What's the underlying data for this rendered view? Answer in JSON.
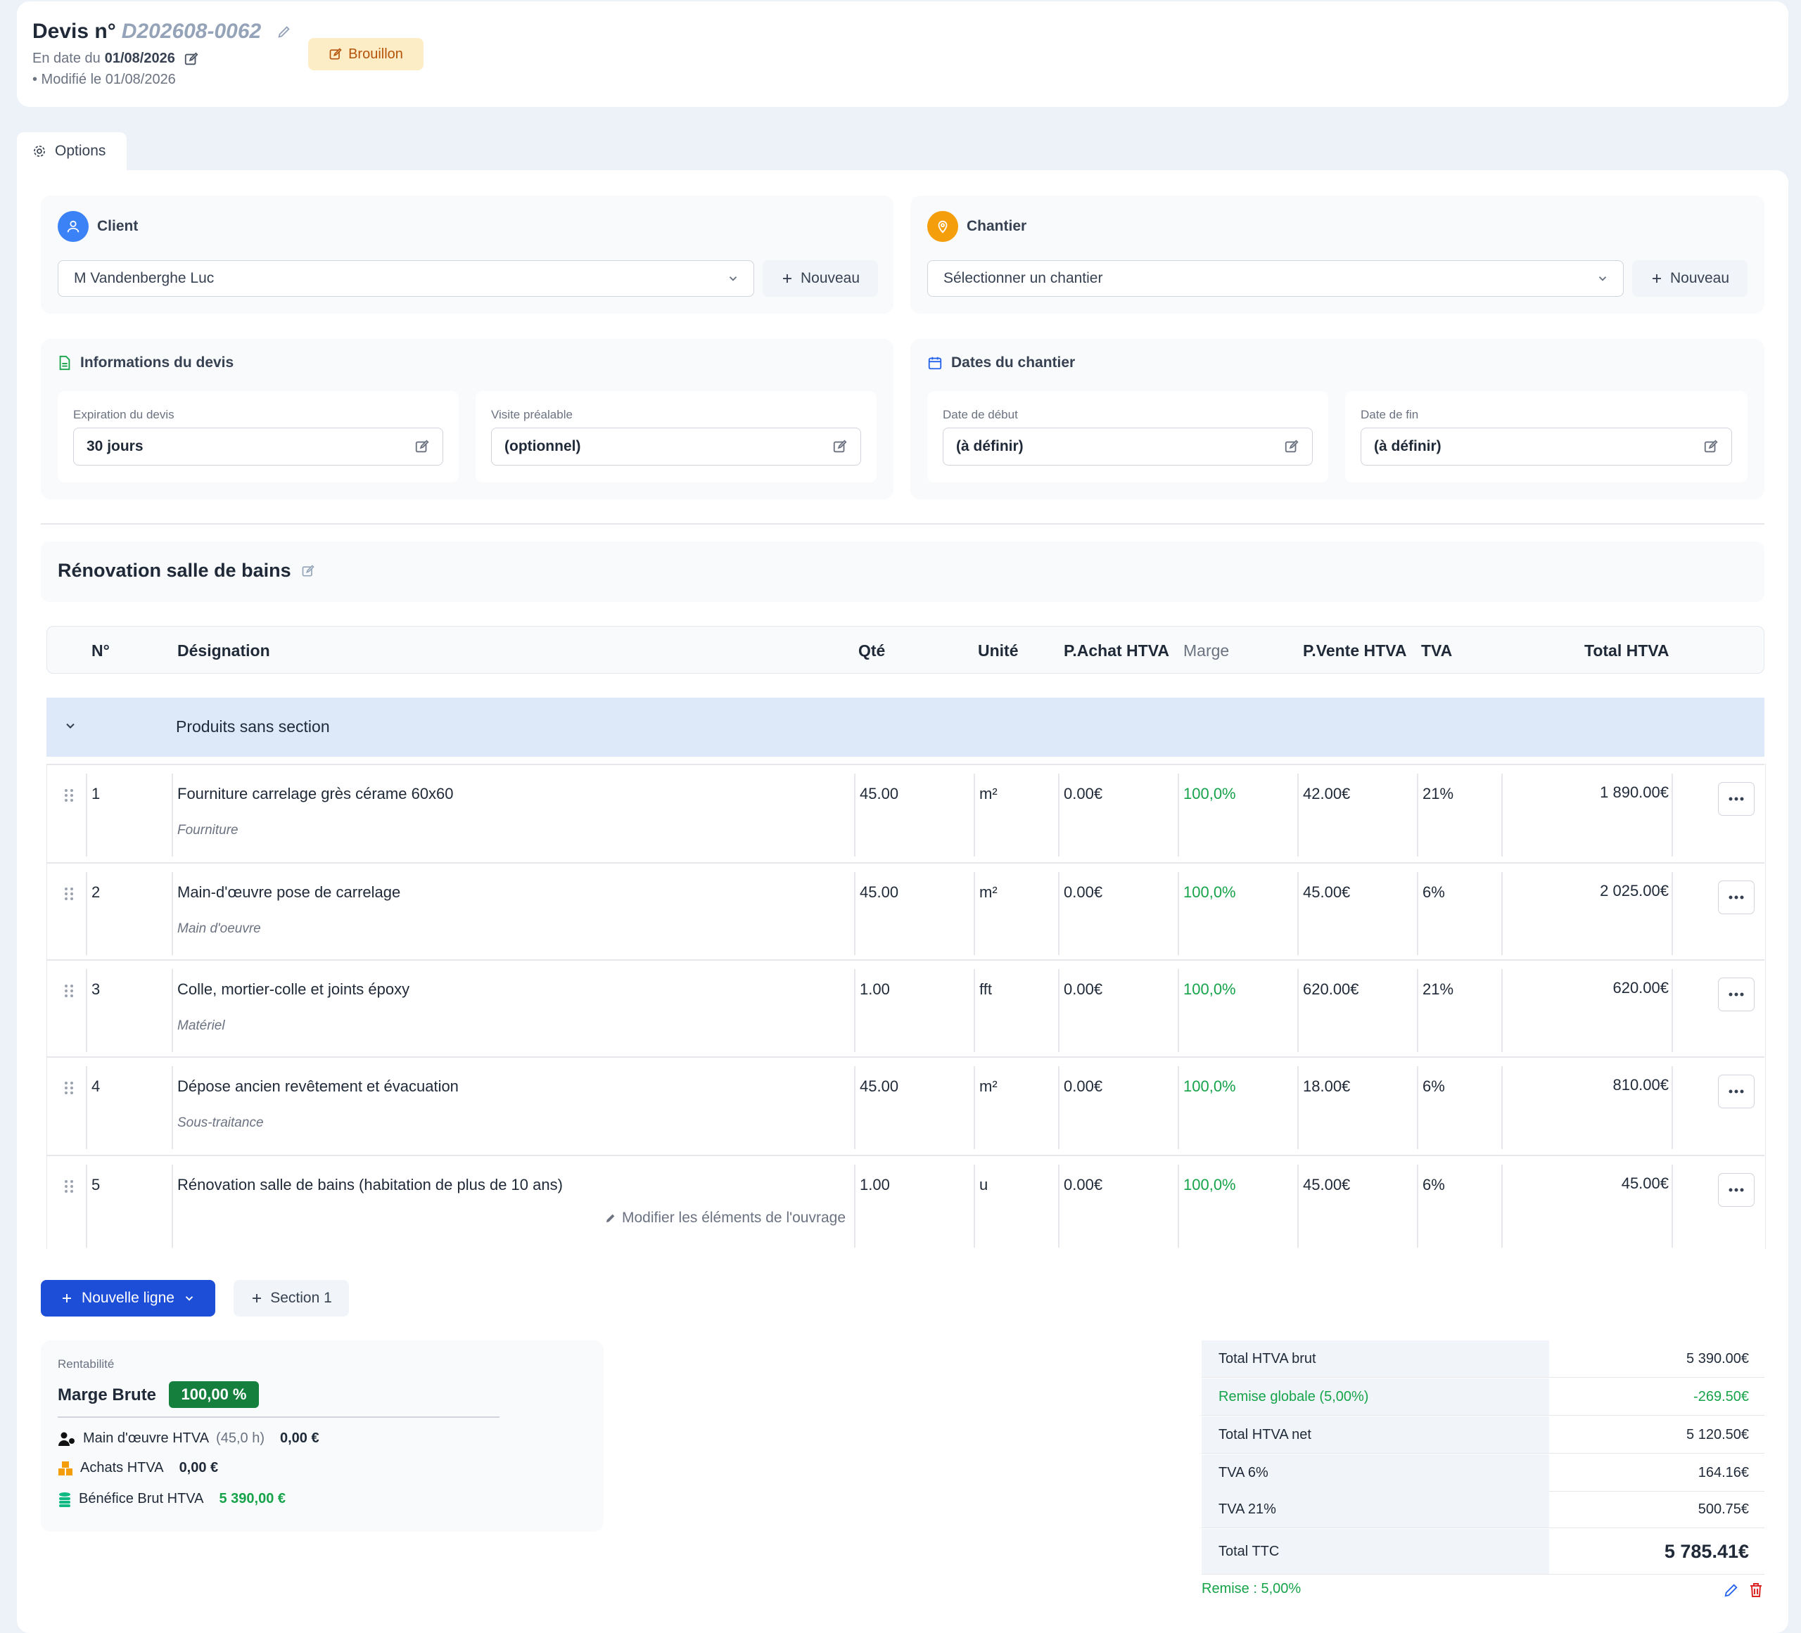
{
  "header": {
    "title_label": "Devis n°",
    "number": "D202608-0062",
    "date_prefix": "En date du",
    "date": "01/08/2026",
    "modified": "• Modifié le 01/08/2026",
    "status": "Brouillon"
  },
  "options_tab": "Options",
  "client": {
    "title": "Client",
    "selected": "M Vandenberghe Luc",
    "new_label": "Nouveau"
  },
  "chantier": {
    "title": "Chantier",
    "placeholder": "Sélectionner un chantier",
    "new_label": "Nouveau"
  },
  "info": {
    "title": "Informations du devis",
    "expiration_label": "Expiration du devis",
    "expiration_value": "30 jours",
    "visite_label": "Visite préalable",
    "visite_value": "(optionnel)"
  },
  "dates": {
    "title": "Dates du chantier",
    "start_label": "Date de début",
    "start_value": "(à définir)",
    "end_label": "Date de fin",
    "end_value": "(à définir)"
  },
  "section_title": "Rénovation salle de bains",
  "table": {
    "headers": {
      "num": "N°",
      "designation": "Désignation",
      "qty": "Qté",
      "unit": "Unité",
      "buy": "P.Achat HTVA",
      "margin": "Marge",
      "sell": "P.Vente HTVA",
      "vat": "TVA",
      "total": "Total HTVA"
    },
    "group_label": "Produits sans section",
    "rows": [
      {
        "num": "1",
        "designation": "Fourniture carrelage grès cérame 60x60",
        "category": "Fourniture",
        "qty": "45.00",
        "unit": "m²",
        "buy": "0.00€",
        "margin": "100,0%",
        "sell": "42.00€",
        "vat": "21%",
        "total": "1 890.00€"
      },
      {
        "num": "2",
        "designation": "Main-d'œuvre pose de carrelage",
        "category": "Main d'oeuvre",
        "qty": "45.00",
        "unit": "m²",
        "buy": "0.00€",
        "margin": "100,0%",
        "sell": "45.00€",
        "vat": "6%",
        "total": "2 025.00€"
      },
      {
        "num": "3",
        "designation": "Colle, mortier-colle et joints époxy",
        "category": "Matériel",
        "qty": "1.00",
        "unit": "fft",
        "buy": "0.00€",
        "margin": "100,0%",
        "sell": "620.00€",
        "vat": "21%",
        "total": "620.00€"
      },
      {
        "num": "4",
        "designation": "Dépose ancien revêtement et évacuation",
        "category": "Sous-traitance",
        "qty": "45.00",
        "unit": "m²",
        "buy": "0.00€",
        "margin": "100,0%",
        "sell": "18.00€",
        "vat": "6%",
        "total": "810.00€"
      },
      {
        "num": "5",
        "designation": "Rénovation salle de bains (habitation de plus de 10 ans)",
        "category": "",
        "qty": "1.00",
        "unit": "u",
        "buy": "0.00€",
        "margin": "100,0%",
        "sell": "45.00€",
        "vat": "6%",
        "total": "45.00€"
      }
    ],
    "edit_ouvrage": "Modifier les éléments de l'ouvrage"
  },
  "actions": {
    "new_line": "Nouvelle ligne",
    "section": "Section 1"
  },
  "profitability": {
    "label": "Rentabilité",
    "marge_title": "Marge Brute",
    "marge_value": "100,00 %",
    "labor_label": "Main d'œuvre HTVA",
    "labor_hours": "(45,0 h)",
    "labor_value": "0,00 €",
    "purchases_label": "Achats HTVA",
    "purchases_value": "0,00 €",
    "profit_label": "Bénéfice Brut HTVA",
    "profit_value": "5 390,00 €"
  },
  "totals": [
    {
      "label": "Total HTVA brut",
      "value": "5 390.00€"
    },
    {
      "label": "Remise globale (5,00%)",
      "value": "-269.50€"
    },
    {
      "label": "Total HTVA net",
      "value": "5 120.50€"
    },
    {
      "label": "TVA 6%",
      "value": "164.16€"
    },
    {
      "label": "TVA 21%",
      "value": "500.75€"
    },
    {
      "label": "Total TTC",
      "value": "5 785.41€"
    }
  ],
  "remise_note": "Remise : 5,00%",
  "colors": {
    "primary": "#1d4ed8",
    "success": "#16a34a",
    "draft_bg": "#fdedc7",
    "draft_text": "#b45309",
    "group_bg": "#dde9f8"
  }
}
